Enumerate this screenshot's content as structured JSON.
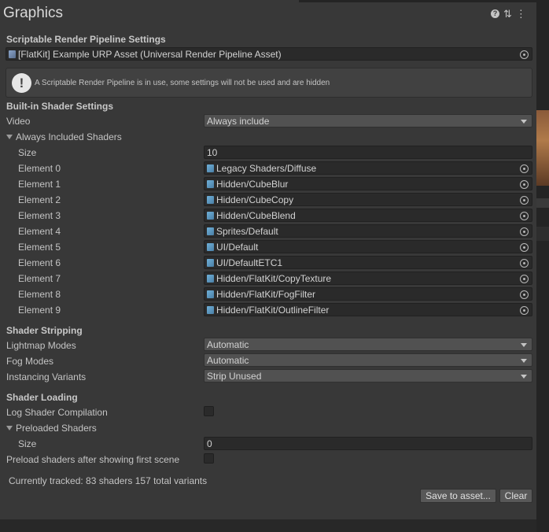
{
  "window": {
    "title": "Graphics"
  },
  "header_icons": [
    "help-icon",
    "preset-sliders-icon",
    "more-vertical-icon"
  ],
  "srp": {
    "heading": "Scriptable Render Pipeline Settings",
    "asset": "[FlatKit] Example URP Asset (Universal Render Pipeline Asset)",
    "warning": "A Scriptable Render Pipeline is in use, some settings will not be used and are hidden"
  },
  "builtin": {
    "heading": "Built-in Shader Settings",
    "video_label": "Video",
    "video_value": "Always include",
    "always_included_label": "Always Included Shaders",
    "size_label": "Size",
    "size_value": "10",
    "elements": [
      {
        "label": "Element 0",
        "value": "Legacy Shaders/Diffuse"
      },
      {
        "label": "Element 1",
        "value": "Hidden/CubeBlur"
      },
      {
        "label": "Element 2",
        "value": "Hidden/CubeCopy"
      },
      {
        "label": "Element 3",
        "value": "Hidden/CubeBlend"
      },
      {
        "label": "Element 4",
        "value": "Sprites/Default"
      },
      {
        "label": "Element 5",
        "value": "UI/Default"
      },
      {
        "label": "Element 6",
        "value": "UI/DefaultETC1"
      },
      {
        "label": "Element 7",
        "value": "Hidden/FlatKit/CopyTexture"
      },
      {
        "label": "Element 8",
        "value": "Hidden/FlatKit/FogFilter"
      },
      {
        "label": "Element 9",
        "value": "Hidden/FlatKit/OutlineFilter"
      }
    ]
  },
  "stripping": {
    "heading": "Shader Stripping",
    "lightmap_label": "Lightmap Modes",
    "lightmap_value": "Automatic",
    "fog_label": "Fog Modes",
    "fog_value": "Automatic",
    "instancing_label": "Instancing Variants",
    "instancing_value": "Strip Unused"
  },
  "loading": {
    "heading": "Shader Loading",
    "log_label": "Log Shader Compilation",
    "log_checked": false,
    "preloaded_label": "Preloaded Shaders",
    "size_label": "Size",
    "size_value": "0",
    "preload_after_label": "Preload shaders after showing first scene",
    "preload_after_checked": false
  },
  "footer": {
    "tracked": "Currently tracked: 83 shaders 157 total variants",
    "save_button": "Save to asset...",
    "clear_button": "Clear"
  }
}
